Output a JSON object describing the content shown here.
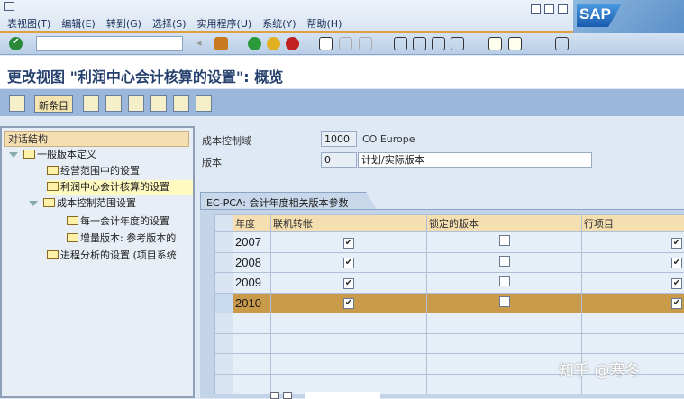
{
  "menu": [
    "表视图(T)",
    "编辑(E)",
    "转到(G)",
    "选择(S)",
    "实用程序(U)",
    "系统(Y)",
    "帮助(H)"
  ],
  "logo": "SAP",
  "command_field": {
    "value": ""
  },
  "page_title": "更改视图 \"利润中心会计核算的设置\": 概览",
  "app_toolbar": {
    "new_entries": "新条目"
  },
  "tree": {
    "header": "对话结构",
    "items": [
      {
        "label": "一般版本定义"
      },
      {
        "label": "经营范围中的设置"
      },
      {
        "label": "利润中心会计核算的设置"
      },
      {
        "label": "成本控制范围设置"
      },
      {
        "label": "每一会计年度的设置"
      },
      {
        "label": "增量版本: 参考版本的"
      },
      {
        "label": "进程分析的设置 (项目系统"
      }
    ]
  },
  "fields": {
    "co_area_label": "成本控制域",
    "co_area_value": "1000",
    "co_area_desc": "CO Europe",
    "version_label": "版本",
    "version_value": "0",
    "version_desc": "计划/实际版本"
  },
  "table": {
    "tab": "EC-PCA: 会计年度相关版本参数",
    "columns": [
      "年度",
      "联机转帐",
      "锁定的版本",
      "行项目"
    ],
    "rows": [
      {
        "year": "2007",
        "online": true,
        "locked": false,
        "line_items": true
      },
      {
        "year": "2008",
        "online": true,
        "locked": false,
        "line_items": true
      },
      {
        "year": "2009",
        "online": true,
        "locked": false,
        "line_items": true
      },
      {
        "year": "2010",
        "online": true,
        "locked": false,
        "line_items": true
      }
    ]
  },
  "watermark": "知乎 @寒冬"
}
